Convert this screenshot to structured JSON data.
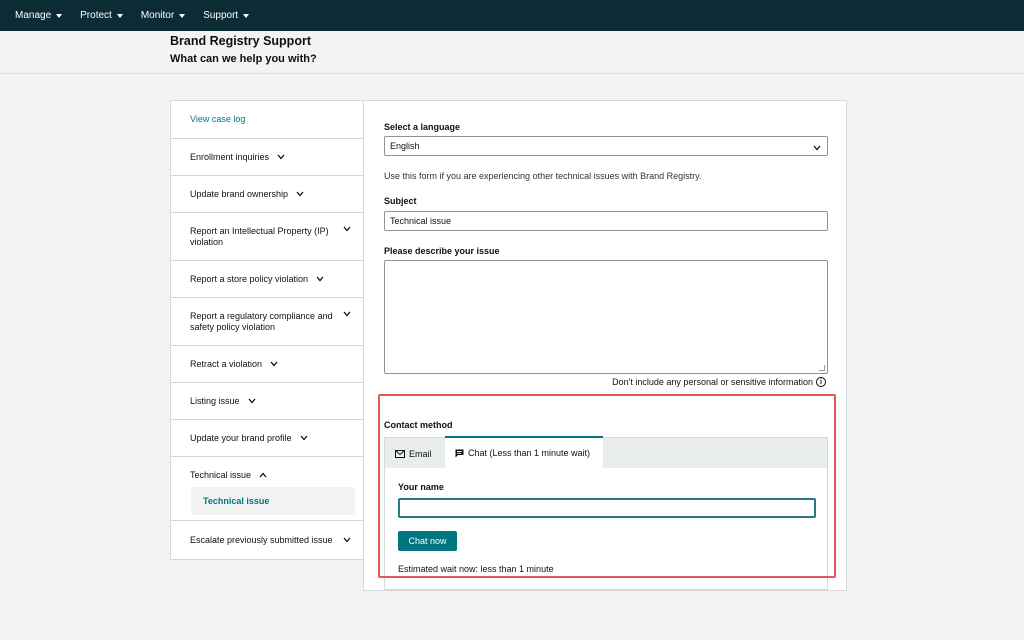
{
  "nav": {
    "items": [
      {
        "label": "Manage"
      },
      {
        "label": "Protect"
      },
      {
        "label": "Monitor"
      },
      {
        "label": "Support"
      }
    ]
  },
  "header": {
    "title": "Brand Registry Support",
    "subtitle": "What can we help you with?"
  },
  "sidebar": {
    "items": [
      {
        "label": "View case log"
      },
      {
        "label": "Enrollment inquiries"
      },
      {
        "label": "Update brand ownership"
      },
      {
        "label": "Report an Intellectual Property (IP) violation"
      },
      {
        "label": "Report a store policy violation"
      },
      {
        "label": "Report a regulatory compliance and safety policy violation"
      },
      {
        "label": "Retract a violation"
      },
      {
        "label": "Listing issue"
      },
      {
        "label": "Update your brand profile"
      },
      {
        "label": "Technical issue"
      },
      {
        "label": "Technical issue"
      },
      {
        "label": "Escalate previously submitted issue"
      }
    ]
  },
  "form": {
    "language_label": "Select a language",
    "language_value": "English",
    "helper_text": "Use this form if you are experiencing other technical issues with Brand Registry.",
    "subject_label": "Subject",
    "subject_value": "Technical issue",
    "describe_label": "Please describe your issue",
    "describe_value": "",
    "disclaimer": "Don't include any personal or sensitive information",
    "info_glyph": "i"
  },
  "contact": {
    "label": "Contact method",
    "tab_email": "Email",
    "tab_chat": "Chat (Less than 1 minute wait)",
    "name_label": "Your name",
    "name_value": "",
    "chat_button": "Chat now",
    "wait_text": "Estimated wait now: less than 1 minute"
  },
  "colors": {
    "topbar": "#0d2b35",
    "accent": "#00767e",
    "highlight": "#e05a5a"
  }
}
